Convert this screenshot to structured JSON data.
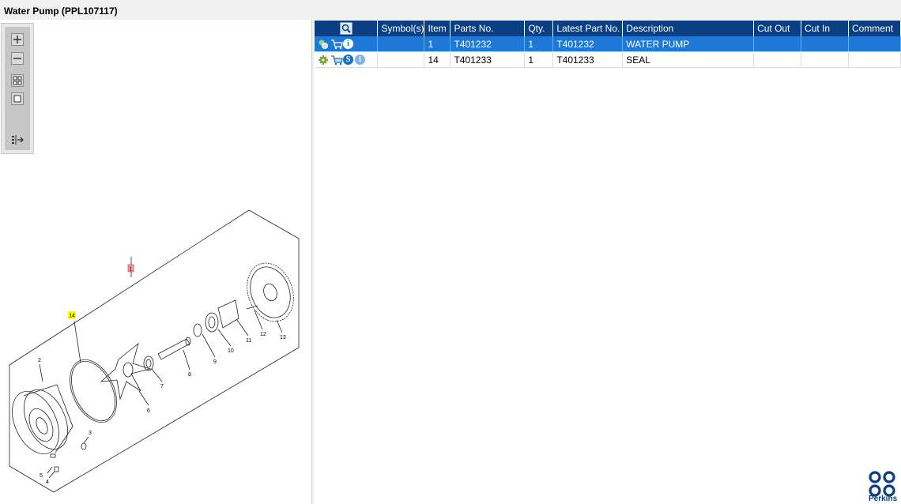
{
  "window": {
    "title": "Water Pump (PPL107117)"
  },
  "viewer_toolbar": {
    "buttons": [
      "zoom-in",
      "zoom-out",
      "fit-all",
      "fit-window",
      "toggle-list"
    ]
  },
  "diagram": {
    "callouts": [
      "1",
      "14",
      "2",
      "3",
      "4",
      "5",
      "6",
      "7",
      "8",
      "9",
      "10",
      "11",
      "12",
      "13"
    ],
    "highlight_selected": "1",
    "highlight_other": "14"
  },
  "table": {
    "headers": {
      "actions_icon": "table-search-icon",
      "symbols": "Symbol(s)",
      "item": "Item",
      "parts_no": "Parts No.",
      "qty": "Qty.",
      "latest": "Latest Part No.",
      "description": "Description",
      "cut_out": "Cut Out",
      "cut_in": "Cut In",
      "comment": "Comment"
    },
    "rows": [
      {
        "item": "1",
        "parts_no": "T401232",
        "qty": "1",
        "latest": "T401232",
        "description": "WATER PUMP",
        "cut_out": "",
        "cut_in": "",
        "comment": "",
        "selected": true
      },
      {
        "item": "14",
        "parts_no": "T401233",
        "qty": "1",
        "latest": "T401233",
        "description": "SEAL",
        "cut_out": "",
        "cut_in": "",
        "comment": "",
        "selected": false
      }
    ]
  },
  "brand": {
    "name": "Perkins",
    "color": "#0b3f84"
  },
  "colors": {
    "header": "#0b3f84",
    "selected_row": "#1e78d7",
    "callout_selected": "#f4a0a0",
    "callout_other": "#ffff00"
  }
}
